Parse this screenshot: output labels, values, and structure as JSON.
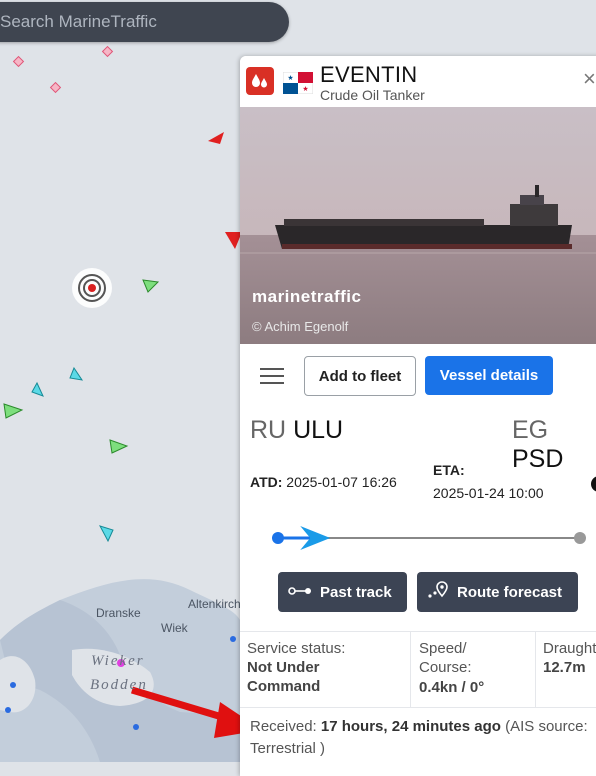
{
  "search": {
    "placeholder": "Search MarineTraffic"
  },
  "map": {
    "places": [
      "Dranske",
      "Altenkirch",
      "Wiek"
    ],
    "water_labels": [
      "Wieker",
      "Bodden"
    ]
  },
  "vessel": {
    "name": "EVENTIN",
    "type": "Crude Oil Tanker",
    "type_icon": "tanker-droplet-icon",
    "flag": "panama-flag",
    "close_label": "×"
  },
  "photo": {
    "watermark": "marinetraffic",
    "credit": "© Achim Egenolf"
  },
  "actions": {
    "add_to_fleet": "Add to fleet",
    "vessel_details": "Vessel details",
    "past_track": "Past track",
    "route_forecast": "Route forecast"
  },
  "voyage": {
    "from_country": "RU",
    "from_port": "ULU",
    "to_country": "EG",
    "to_port": "PSD",
    "atd_label": "ATD:",
    "atd_value": "2025-01-07 16:26",
    "eta_label": "ETA:",
    "eta_value": "2025-01-24 10:00",
    "progress": 0.12
  },
  "stats": {
    "service_label": "Service status:",
    "service_value": "Not Under Command",
    "speed_label": "Speed/ Course:",
    "speed_value": "0.4kn / 0°",
    "draught_label": "Draught",
    "draught_value": "12.7m"
  },
  "received": {
    "label": "Received:",
    "value": "17 hours, 24 minutes ago",
    "source": "(AIS source: Terrestrial )"
  },
  "colors": {
    "accent": "#1a73e8",
    "alert": "#d93025",
    "dark_button": "#3c4454"
  }
}
